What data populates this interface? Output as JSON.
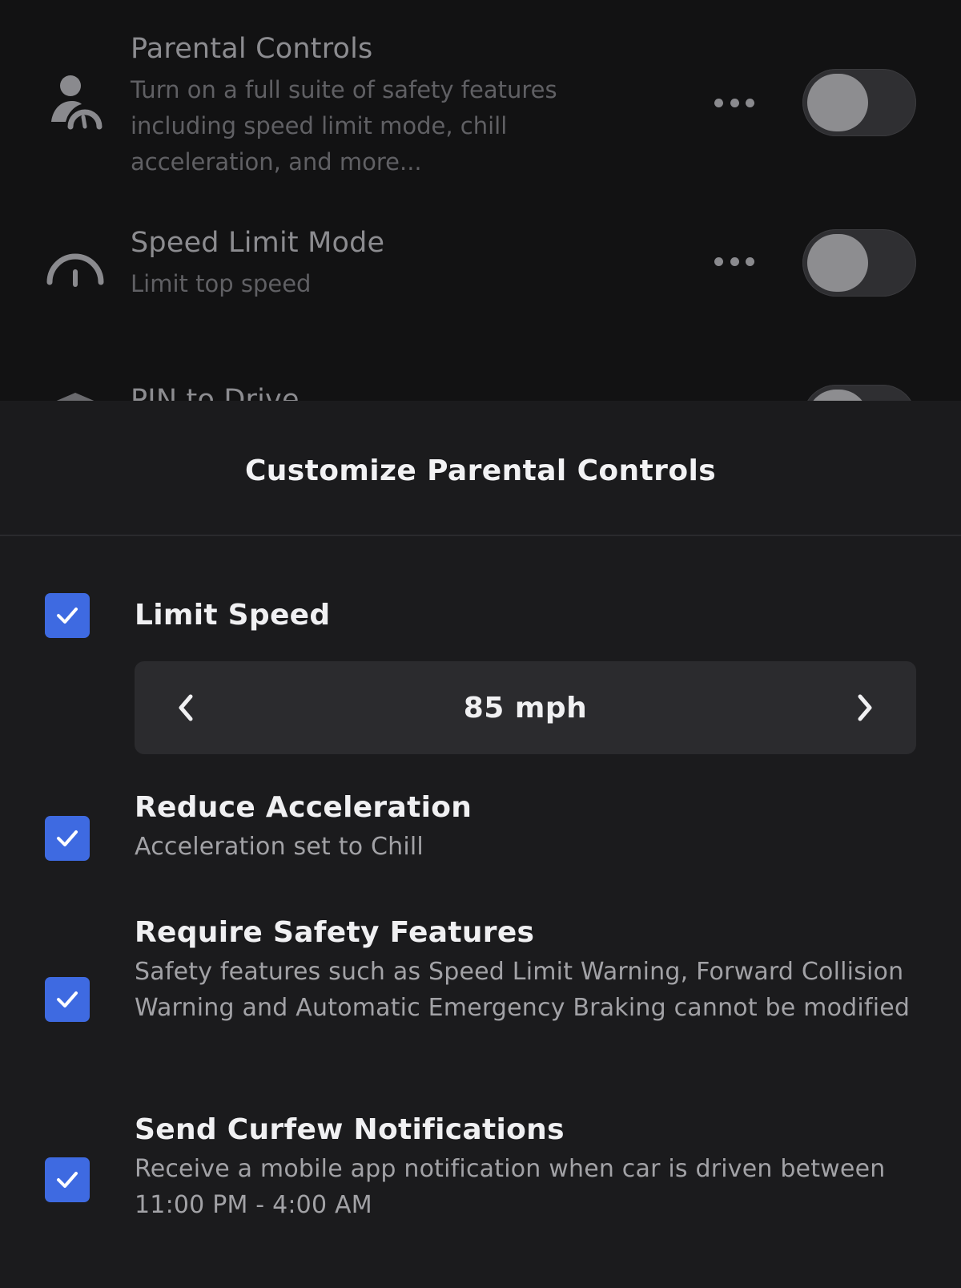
{
  "background_settings": {
    "items": [
      {
        "title": "Parental Controls",
        "description": "Turn on a full suite of safety features including speed limit mode, chill acceleration, and more...",
        "icon": "parental-controls-icon",
        "enabled": false
      },
      {
        "title": "Speed Limit Mode",
        "description": "Limit top speed",
        "icon": "speedometer-icon",
        "enabled": false
      },
      {
        "title": "PIN to Drive",
        "icon": "shield-icon",
        "enabled": false
      }
    ]
  },
  "sheet": {
    "title": "Customize Parental Controls",
    "options": [
      {
        "title": "Limit Speed",
        "checked": true,
        "stepper": {
          "value": "85 mph"
        }
      },
      {
        "title": "Reduce Acceleration",
        "description": "Acceleration set to Chill",
        "checked": true
      },
      {
        "title": "Require Safety Features",
        "description": "Safety features such as Speed Limit Warning, Forward Collision Warning and Automatic Emergency Braking cannot be modified",
        "checked": true
      },
      {
        "title": "Send Curfew Notifications",
        "description": "Receive a mobile app notification when car is driven between 11:00 PM - 4:00 AM",
        "checked": true
      }
    ]
  },
  "colors": {
    "accent_checkbox": "#3e6ae1",
    "sheet_background": "#1b1b1d",
    "background_list": "#121213"
  }
}
